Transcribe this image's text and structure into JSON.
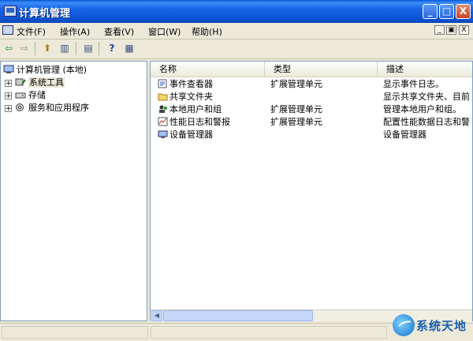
{
  "window": {
    "title": "计算机管理",
    "controls": {
      "minimize": "_",
      "maximize": "□",
      "close": "X"
    }
  },
  "menubar": {
    "items": [
      {
        "label": "文件(F)"
      },
      {
        "label": "操作(A)"
      },
      {
        "label": "查看(V)"
      },
      {
        "label": "窗口(W)"
      },
      {
        "label": "帮助(H)"
      }
    ],
    "mdi": {
      "minimize": "_",
      "restore": "▣",
      "close": "X"
    }
  },
  "toolbar": {
    "buttons": [
      {
        "icon": "back-arrow-icon",
        "glyph": "⇦"
      },
      {
        "icon": "forward-arrow-icon",
        "glyph": "⇨"
      },
      {
        "icon": "up-folder-icon",
        "glyph": "⬆"
      },
      {
        "icon": "show-hide-tree-icon",
        "glyph": "▥"
      },
      {
        "icon": "export-list-icon",
        "glyph": "▤"
      },
      {
        "icon": "help-icon",
        "glyph": "?"
      },
      {
        "icon": "properties-icon",
        "glyph": "▦"
      }
    ]
  },
  "tree": {
    "root": "计算机管理 (本地)",
    "children": [
      {
        "label": "系统工具",
        "expander": "+"
      },
      {
        "label": "存储",
        "expander": "+"
      },
      {
        "label": "服务和应用程序",
        "expander": "+"
      }
    ]
  },
  "list": {
    "columns": [
      {
        "label": "名称"
      },
      {
        "label": "类型"
      },
      {
        "label": "描述"
      }
    ],
    "rows": [
      {
        "name": "事件查看器",
        "type": "扩展管理单元",
        "desc": "显示事件日志。",
        "icon": "event-viewer-icon"
      },
      {
        "name": "共享文件夹",
        "type": "",
        "desc": "显示共享文件夹、目前",
        "icon": "shared-folder-icon"
      },
      {
        "name": "本地用户和组",
        "type": "扩展管理单元",
        "desc": "管理本地用户和组。",
        "icon": "users-icon"
      },
      {
        "name": "性能日志和警报",
        "type": "扩展管理单元",
        "desc": "配置性能数据日志和警",
        "icon": "performance-icon"
      },
      {
        "name": "设备管理器",
        "type": "",
        "desc": "设备管理器",
        "icon": "device-manager-icon"
      }
    ]
  },
  "watermark": {
    "text": "系统天地"
  },
  "colors": {
    "titlebar": "#0A51D2",
    "chrome": "#ECE9D8",
    "border": "#7F9DB9"
  }
}
